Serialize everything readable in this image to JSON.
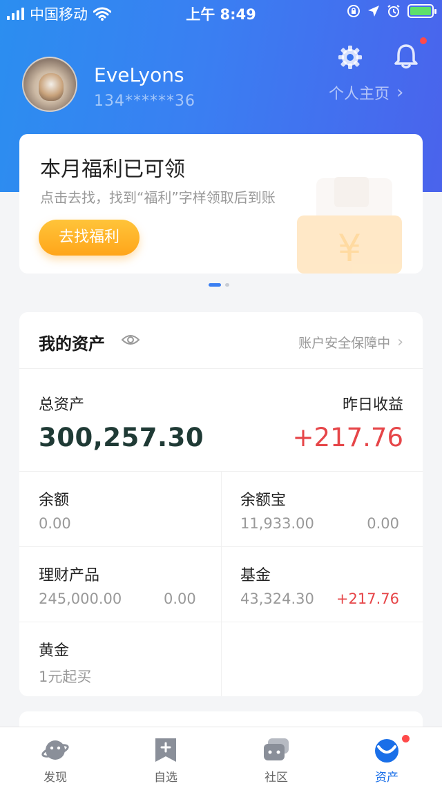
{
  "status_bar": {
    "carrier": "中国移动",
    "time": "上午 8:49"
  },
  "profile": {
    "username": "EveLyons",
    "phone": "134******36",
    "profile_link": "个人主页"
  },
  "welfare": {
    "title": "本月福利已可领",
    "subtitle": "点击去找，找到“福利”字样领取后到账",
    "button": "去找福利"
  },
  "assets": {
    "title": "我的资产",
    "safety": "账户安全保障中",
    "total_label": "总资产",
    "total_value": "300,257.30",
    "yesterday_label": "昨日收益",
    "yesterday_value": "+217.76",
    "items": [
      {
        "label": "余额",
        "amount": "0.00",
        "income": ""
      },
      {
        "label": "余额宝",
        "amount": "11,933.00",
        "income": "0.00"
      },
      {
        "label": "理财产品",
        "amount": "245,000.00",
        "income": "0.00"
      },
      {
        "label": "基金",
        "amount": "43,324.30",
        "income": "+217.76"
      },
      {
        "label": "黄金",
        "amount": "1元起买",
        "income": ""
      }
    ]
  },
  "tabbar": {
    "tabs": [
      {
        "label": "发现",
        "icon": "planet-icon"
      },
      {
        "label": "自选",
        "icon": "bookmark-plus-icon"
      },
      {
        "label": "社区",
        "icon": "chat-bubbles-icon"
      },
      {
        "label": "资产",
        "icon": "assets-check-icon"
      }
    ],
    "active_index": 3
  },
  "colors": {
    "brand_blue": "#3a7ff2",
    "accent_orange": "#ffa51a",
    "profit_red": "#e64548",
    "badge_red": "#ff4a4a"
  }
}
